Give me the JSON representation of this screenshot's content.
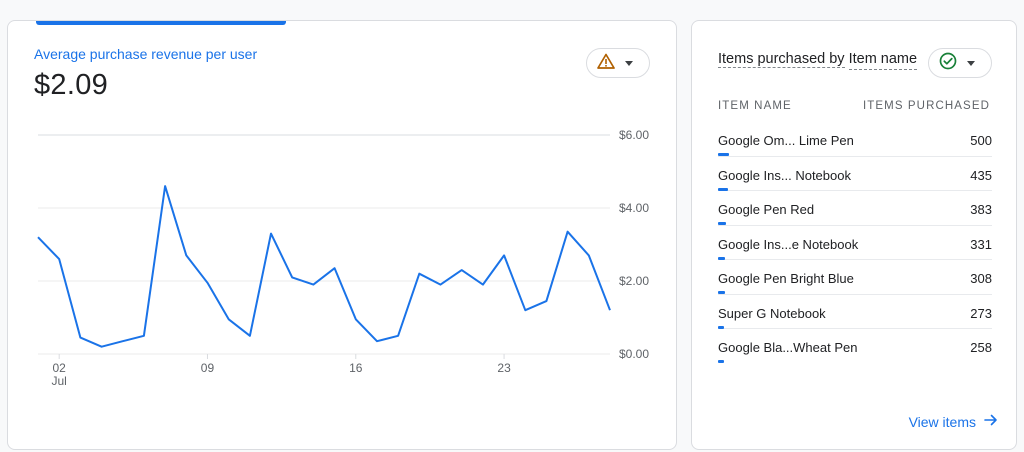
{
  "left_card": {
    "metric_label": "Average purchase revenue per user",
    "metric_value": "$2.09",
    "status_icon": "warning-triangle-icon"
  },
  "right_card": {
    "title_line1": "Items purchased by",
    "title_line2": "Item name",
    "status_icon": "check-circle-icon",
    "col_name": "ITEM NAME",
    "col_value": "ITEMS PURCHASED",
    "rows": [
      {
        "name": "Google Om... Lime Pen",
        "value": "500",
        "share": 0.04
      },
      {
        "name": "Google Ins... Notebook",
        "value": "435",
        "share": 0.035
      },
      {
        "name": "Google Pen Red",
        "value": "383",
        "share": 0.031
      },
      {
        "name": "Google Ins...e Notebook",
        "value": "331",
        "share": 0.027
      },
      {
        "name": "Google Pen Bright Blue",
        "value": "308",
        "share": 0.025
      },
      {
        "name": "Super G Notebook",
        "value": "273",
        "share": 0.022
      },
      {
        "name": "Google Bla...Wheat Pen",
        "value": "258",
        "share": 0.021
      }
    ],
    "view_link": "View items"
  },
  "colors": {
    "accent": "#1a73e8",
    "warning": "#b06000",
    "success": "#188038"
  },
  "chart_data": {
    "type": "line",
    "x": [
      1,
      2,
      3,
      4,
      5,
      6,
      7,
      8,
      9,
      10,
      11,
      12,
      13,
      14,
      15,
      16,
      17,
      18,
      19,
      20,
      21,
      22,
      23,
      24,
      25,
      26,
      27,
      28
    ],
    "series": [
      {
        "values": [
          3.2,
          2.6,
          0.45,
          0.2,
          0.35,
          0.5,
          4.6,
          2.7,
          1.95,
          0.95,
          0.5,
          3.3,
          2.1,
          1.9,
          2.35,
          0.95,
          0.35,
          0.5,
          2.2,
          1.9,
          2.3,
          1.9,
          2.7,
          1.2,
          1.45,
          3.35,
          2.7,
          1.2
        ]
      }
    ],
    "x_ticks": [
      {
        "x": 2,
        "label": "02",
        "sub": "Jul"
      },
      {
        "x": 9,
        "label": "09",
        "sub": ""
      },
      {
        "x": 16,
        "label": "16",
        "sub": ""
      },
      {
        "x": 23,
        "label": "23",
        "sub": ""
      }
    ],
    "y_ticks": [
      "$6.00",
      "$4.00",
      "$2.00",
      "$0.00"
    ],
    "ylim": [
      0,
      6
    ],
    "grid": true
  }
}
